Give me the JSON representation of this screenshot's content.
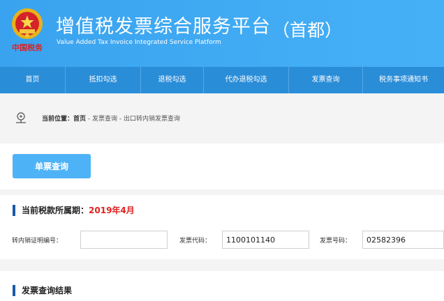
{
  "header": {
    "title": "增值税发票综合服务平台",
    "title_suffix": "（首都）",
    "subtitle": "Value Added Tax Invoice Integrated Service Platform",
    "logo_text": "中国税务"
  },
  "nav": {
    "items": [
      "首页",
      "抵扣勾选",
      "退税勾选",
      "代办退税勾选",
      "发票查询",
      "税务事项通知书"
    ]
  },
  "breadcrumb": {
    "prefix": "当前位置：",
    "home": "首页",
    "rest": " - 发票查询 - 出口转内销发票查询"
  },
  "actions": {
    "query_button": "单票查询"
  },
  "period": {
    "label": "当前税款所属期：",
    "value": "2019年4月"
  },
  "form": {
    "cert_label": "转内销证明编号：",
    "cert_value": "",
    "code_label": "发票代码：",
    "code_value": "1100101140",
    "number_label": "发票号码：",
    "number_value": "02582396"
  },
  "results": {
    "title": "发票查询结果"
  },
  "colors": {
    "header_blue": "#3fa9f5",
    "nav_blue": "#2a8dd8",
    "button_blue": "#4eb3f6",
    "accent_red": "#e02020",
    "section_bar": "#1a5aa6"
  }
}
